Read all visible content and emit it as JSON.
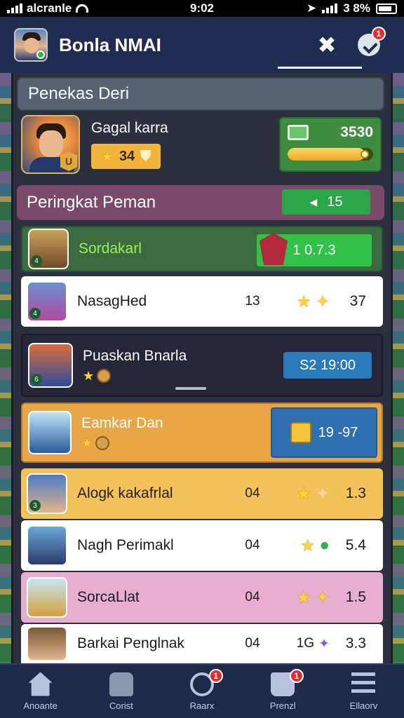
{
  "status_bar": {
    "carrier": "alcranle",
    "time": "9:02",
    "battery": "3 8%"
  },
  "header": {
    "title": "Bonla NMAI",
    "notification_count": "1"
  },
  "profile_section": {
    "title": "Penekas Deri",
    "player_name": "Gagal karra",
    "stars": "34",
    "currency_value": "3530",
    "currency_progress": 0.9
  },
  "ranking_section": {
    "title": "Peringkat Peman",
    "count": "15"
  },
  "rows": [
    {
      "name": "Sordakarl",
      "value": "1 0.7.3"
    },
    {
      "name": "NasagHed",
      "score": "13",
      "value": "37"
    },
    {
      "name": "Puaskan Bnarla",
      "value": "S2 19:00"
    },
    {
      "name": "Eamkar Dan",
      "value": "19 -97"
    },
    {
      "name": "Alogk kakafrlal",
      "score": "04",
      "value": "1.3"
    },
    {
      "name": "Nagh Perimakl",
      "score": "04",
      "value": "5.4"
    },
    {
      "name": "SorcaLlat",
      "score": "04",
      "value": "1.5"
    },
    {
      "name": "Barkai Penglnak",
      "score": "04",
      "extra": "1G",
      "value": "3.3"
    }
  ],
  "bottom_nav": [
    {
      "label": "Anoante"
    },
    {
      "label": "Corist"
    },
    {
      "label": "Raarx",
      "badge": "1"
    },
    {
      "label": "Prenzl",
      "badge": "1"
    },
    {
      "label": "Ellaorv"
    }
  ],
  "colors": {
    "header_bg": "#1f2d52",
    "profile_head": "#596273",
    "ranking_head": "#7a4a6b",
    "accent_green": "#2aa649",
    "gold": "#f2b53b",
    "row_orange": "#e8a646",
    "row_pink": "#e7aecf",
    "row_dark": "#262638"
  }
}
